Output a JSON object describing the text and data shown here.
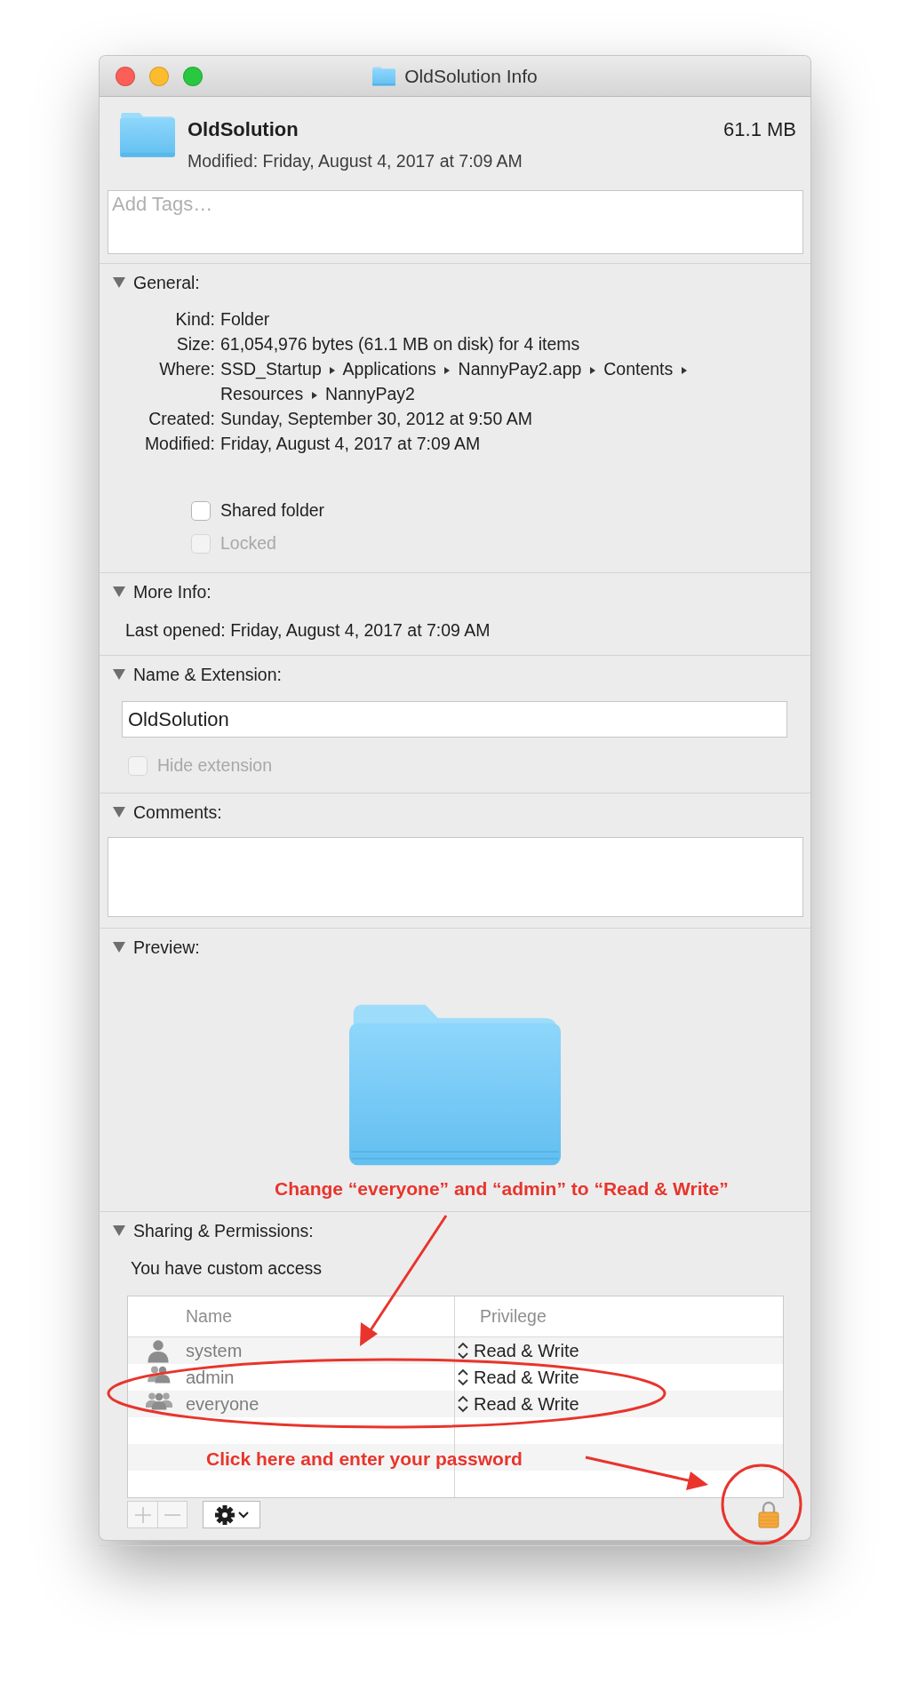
{
  "window": {
    "title": "OldSolution Info"
  },
  "header": {
    "name": "OldSolution",
    "size": "61.1 MB",
    "modified": "Modified: Friday, August 4, 2017 at 7:09 AM"
  },
  "tags": {
    "placeholder": "Add Tags…"
  },
  "sections": [
    {
      "kind": "general",
      "title": "General:",
      "expanded": true,
      "fields": [
        {
          "label": "Kind:",
          "value": "Folder"
        },
        {
          "label": "Size:",
          "value": "61,054,976 bytes (61.1 MB on disk) for 4 items"
        },
        {
          "label": "Where:",
          "path": [
            "SSD_Startup",
            "Applications",
            "NannyPay2.app",
            "Contents",
            "Resources",
            "NannyPay2"
          ]
        },
        {
          "label": "Created:",
          "value": "Sunday, September 30, 2012 at 9:50 AM"
        },
        {
          "label": "Modified:",
          "value": "Friday, August 4, 2017 at 7:09 AM"
        }
      ],
      "checkboxes": [
        {
          "label": "Shared folder",
          "checked": false,
          "disabled": false
        },
        {
          "label": "Locked",
          "checked": false,
          "disabled": true
        }
      ]
    },
    {
      "kind": "more_info",
      "title": "More Info:",
      "expanded": true,
      "fields": [
        {
          "label": "Last opened:",
          "value": "Friday, August 4, 2017 at 7:09 AM"
        }
      ]
    },
    {
      "kind": "name",
      "title": "Name & Extension:",
      "expanded": true,
      "field": {
        "value": "OldSolution"
      },
      "checkboxes": [
        {
          "label": "Hide extension",
          "checked": false,
          "disabled": true
        }
      ]
    },
    {
      "kind": "comments",
      "title": "Comments:",
      "expanded": true
    },
    {
      "kind": "preview",
      "title": "Preview:",
      "expanded": true
    },
    {
      "kind": "sharing",
      "title": "Sharing & Permissions:",
      "expanded": true,
      "note": "You have custom access",
      "columns": [
        "Name",
        "Privilege"
      ],
      "rows": [
        {
          "name": "system",
          "kind": "user",
          "privilege": "Read & Write"
        },
        {
          "name": "admin",
          "kind": "group",
          "privilege": "Read & Write"
        },
        {
          "name": "everyone",
          "kind": "everyone",
          "privilege": "Read & Write"
        }
      ],
      "locked": true
    }
  ],
  "annotations": [
    {
      "text": "Change “everyone” and “admin” to “Read & Write”"
    },
    {
      "text": "Click here and enter your password"
    }
  ]
}
